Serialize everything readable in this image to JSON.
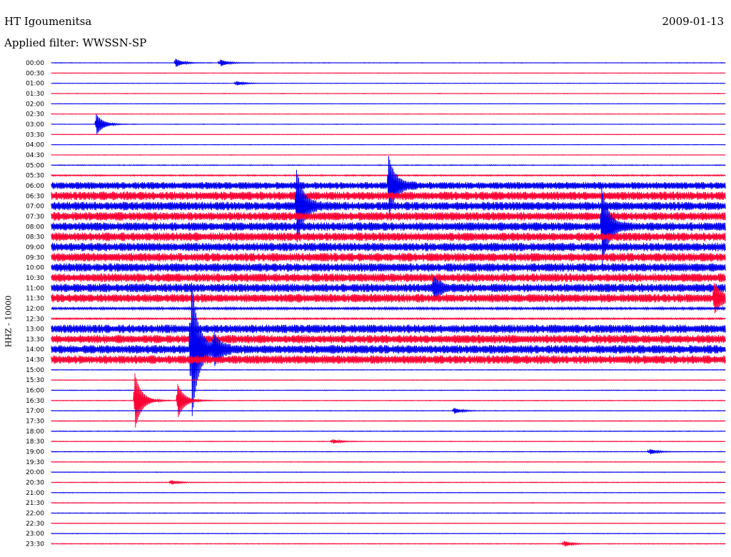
{
  "header": {
    "station": "HT Igoumenitsa",
    "date": "2009-01-13",
    "filter": "Applied filter: WWSSN-SP"
  },
  "channel_label": "HHZ - 10000",
  "colors": {
    "blue": "#0000ee",
    "red": "#ff0033"
  },
  "chart_data": {
    "type": "line",
    "title": "HT Igoumenitsa",
    "rows": [
      "00:00",
      "00:30",
      "01:00",
      "01:30",
      "02:00",
      "02:30",
      "03:00",
      "03:30",
      "04:00",
      "04:30",
      "05:00",
      "05:30",
      "06:00",
      "06:30",
      "07:00",
      "07:30",
      "08:00",
      "08:30",
      "09:00",
      "09:30",
      "10:00",
      "10:30",
      "11:00",
      "11:30",
      "12:00",
      "12:30",
      "13:00",
      "13:30",
      "14:00",
      "14:30",
      "15:00",
      "15:30",
      "16:00",
      "16:30",
      "17:00",
      "17:30",
      "18:00",
      "18:30",
      "19:00",
      "19:30",
      "20:00",
      "20:30",
      "21:00",
      "21:30",
      "22:00",
      "22:30",
      "23:00",
      "23:30"
    ],
    "row_minutes": 30,
    "noise_level": [
      0.3,
      0.3,
      0.3,
      0.3,
      0.3,
      0.3,
      0.3,
      0.3,
      0.3,
      0.3,
      0.5,
      0.8,
      5,
      6,
      6,
      6,
      6,
      6,
      6,
      6,
      6,
      6,
      6,
      6,
      1.5,
      1,
      6,
      6,
      6,
      6,
      0.4,
      0.4,
      0.4,
      0.4,
      0.4,
      0.4,
      0.4,
      0.4,
      0.4,
      0.4,
      0.4,
      0.4,
      0.4,
      0.4,
      0.4,
      0.4,
      0.4,
      0.4
    ],
    "events": [
      {
        "row": 0,
        "min": 5.5,
        "amp": 6
      },
      {
        "row": 0,
        "min": 7.5,
        "amp": 5
      },
      {
        "row": 2,
        "min": 8.2,
        "amp": 3
      },
      {
        "row": 6,
        "min": 2.0,
        "amp": 14
      },
      {
        "row": 12,
        "min": 15.0,
        "amp": 40
      },
      {
        "row": 14,
        "min": 10.9,
        "amp": 50
      },
      {
        "row": 16,
        "min": 24.5,
        "amp": 50
      },
      {
        "row": 22,
        "min": 17.0,
        "amp": 14
      },
      {
        "row": 23,
        "min": 29.5,
        "amp": 18
      },
      {
        "row": 28,
        "min": 6.2,
        "amp": 105
      },
      {
        "row": 28,
        "min": 7.2,
        "amp": 20
      },
      {
        "row": 33,
        "min": 3.7,
        "amp": 40
      },
      {
        "row": 33,
        "min": 5.6,
        "amp": 25
      },
      {
        "row": 34,
        "min": 17.9,
        "amp": 4
      },
      {
        "row": 37,
        "min": 12.5,
        "amp": 3
      },
      {
        "row": 38,
        "min": 26.6,
        "amp": 4
      },
      {
        "row": 41,
        "min": 5.3,
        "amp": 3
      },
      {
        "row": 47,
        "min": 22.8,
        "amp": 4
      }
    ],
    "xlim": [
      0,
      30
    ],
    "xlabel": "",
    "ylabel": "HHZ - 10000"
  }
}
